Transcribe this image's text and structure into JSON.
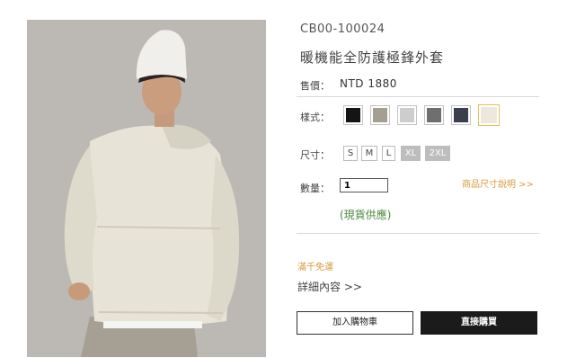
{
  "product": {
    "sku": "CB00-100024",
    "title": "暖機能全防護極鋒外套",
    "price_label": "售價：",
    "price_value": "NTD 1880",
    "style_label": "樣式：",
    "colors": [
      {
        "name": "black",
        "hex": "#141414"
      },
      {
        "name": "taupe",
        "hex": "#a59f91"
      },
      {
        "name": "light-gray",
        "hex": "#cdcdcd"
      },
      {
        "name": "dark-gray",
        "hex": "#6f6f6f"
      },
      {
        "name": "navy",
        "hex": "#3b3e4e"
      },
      {
        "name": "ivory",
        "hex": "#ece8dc",
        "selected": true
      }
    ],
    "size_label": "尺寸：",
    "sizes": [
      {
        "label": "S",
        "available": true
      },
      {
        "label": "M",
        "available": true
      },
      {
        "label": "L",
        "available": true
      },
      {
        "label": "XL",
        "available": false
      },
      {
        "label": "2XL",
        "available": false
      }
    ],
    "qty_label": "數量：",
    "qty_value": "1",
    "size_guide": "商品尺寸說明 >>",
    "stock_status": "(現貨供應)",
    "shipping_note": "滿千免運",
    "details_link": "詳細內容 >>",
    "add_to_cart": "加入購物車",
    "buy_now": "直接購買"
  },
  "colors": {
    "accent": "#d99a3e",
    "stock": "#4a8a3a",
    "buy_button": "#1b1b1b"
  }
}
